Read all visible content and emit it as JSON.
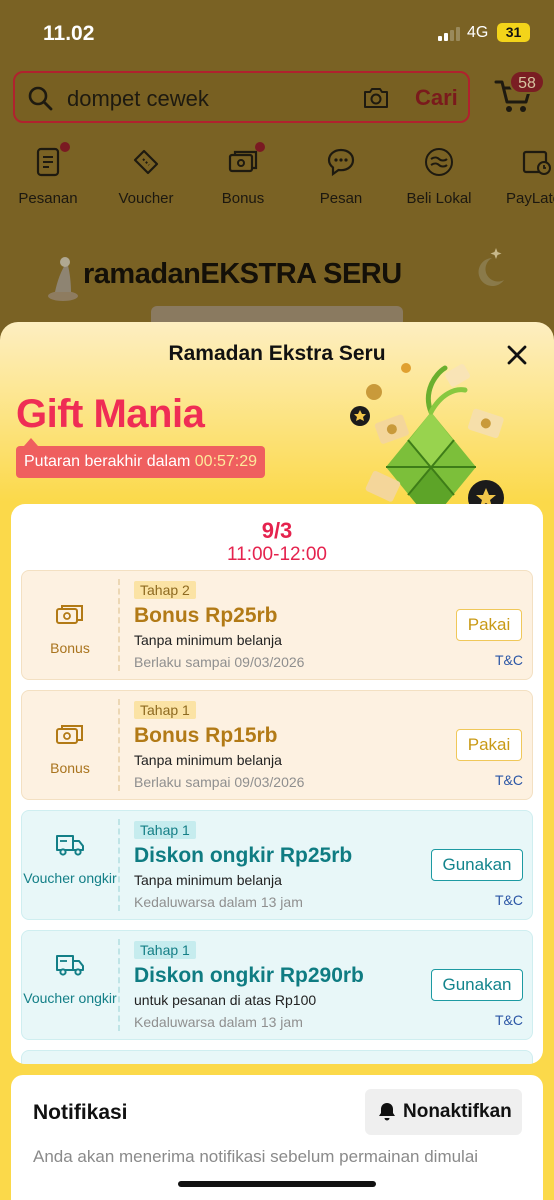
{
  "status_bar": {
    "time": "11.02",
    "network": "4G",
    "battery": "31"
  },
  "search": {
    "query": "dompet cewek",
    "button_label": "Cari",
    "cart_count": "58"
  },
  "quick_menu": [
    {
      "label": "Pesanan",
      "icon": "orders-icon",
      "dot": true
    },
    {
      "label": "Voucher",
      "icon": "voucher-icon",
      "dot": false
    },
    {
      "label": "Bonus",
      "icon": "bonus-icon",
      "dot": true
    },
    {
      "label": "Pesan",
      "icon": "chat-icon",
      "dot": false
    },
    {
      "label": "Beli Lokal",
      "icon": "beli-lokal-icon",
      "dot": false
    },
    {
      "label": "PayLater",
      "icon": "paylater-icon",
      "dot": false
    }
  ],
  "banner": {
    "title_light": "ramadan",
    "title_bold": "EKSTRA SERU"
  },
  "sheet": {
    "title": "Ramadan Ekstra Seru",
    "heading": "Gift Mania",
    "countdown_label": "Putaran berakhir dalam",
    "countdown_time": "00:57:29",
    "date": "9/3",
    "time_range": "11:00-12:00"
  },
  "vouchers": [
    {
      "type": "bonus",
      "left_label": "Bonus",
      "tier": "Tahap 2",
      "title": "Bonus Rp25rb",
      "subtitle": "Tanpa minimum belanja",
      "validity": "Berlaku sampai 09/03/2026",
      "button": "Pakai",
      "tnc": "T&C"
    },
    {
      "type": "bonus",
      "left_label": "Bonus",
      "tier": "Tahap 1",
      "title": "Bonus Rp15rb",
      "subtitle": "Tanpa minimum belanja",
      "validity": "Berlaku sampai 09/03/2026",
      "button": "Pakai",
      "tnc": "T&C"
    },
    {
      "type": "ship",
      "left_label": "Voucher ongkir",
      "tier": "Tahap 1",
      "title": "Diskon ongkir Rp25rb",
      "subtitle": "Tanpa minimum belanja",
      "validity": "Kedaluwarsa dalam 13 jam",
      "button": "Gunakan",
      "tnc": "T&C"
    },
    {
      "type": "ship",
      "left_label": "Voucher ongkir",
      "tier": "Tahap 1",
      "title": "Diskon ongkir Rp290rb",
      "subtitle": "untuk pesanan di atas Rp100",
      "validity": "Kedaluwarsa dalam 13 jam",
      "button": "Gunakan",
      "tnc": "T&C"
    }
  ],
  "notification": {
    "title": "Notifikasi",
    "button": "Nonaktifkan",
    "description": "Anda akan menerima notifikasi sebelum permainan dimulai"
  },
  "colors": {
    "accent": "#ef2d55",
    "bonus": "#b27a16",
    "shipping": "#0f7c82",
    "sheet_yellow": "#fbd94a"
  }
}
